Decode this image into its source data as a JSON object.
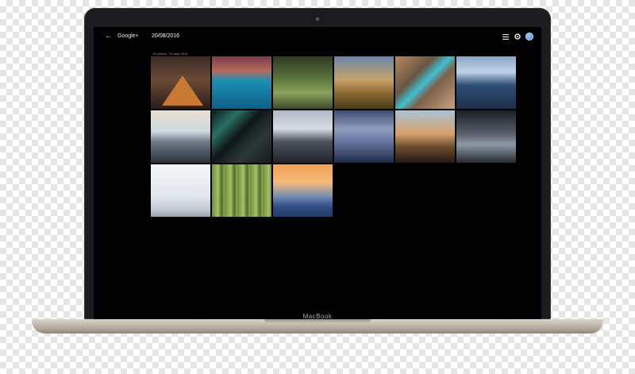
{
  "device": {
    "brand_label": "MacBook"
  },
  "app": {
    "back_icon": "arrow-left-icon",
    "brand": "Google+",
    "album_date": "20/08/2016"
  },
  "toolbar": {
    "icons": [
      "list-icon",
      "settings-icon",
      "avatar-icon"
    ]
  },
  "album": {
    "photo_count": "15 photos",
    "date_range": "20 août 2016"
  },
  "photos": [
    {
      "subject": "pyramid"
    },
    {
      "subject": "coast"
    },
    {
      "subject": "forest"
    },
    {
      "subject": "balloons"
    },
    {
      "subject": "river-aerial"
    },
    {
      "subject": "fjord"
    },
    {
      "subject": "city-skyline"
    },
    {
      "subject": "aerial-abstract"
    },
    {
      "subject": "mountains"
    },
    {
      "subject": "misty-hills"
    },
    {
      "subject": "desert-town"
    },
    {
      "subject": "bridge-street"
    },
    {
      "subject": "snowy-summit"
    },
    {
      "subject": "bamboo"
    },
    {
      "subject": "sunset-mountain"
    }
  ]
}
